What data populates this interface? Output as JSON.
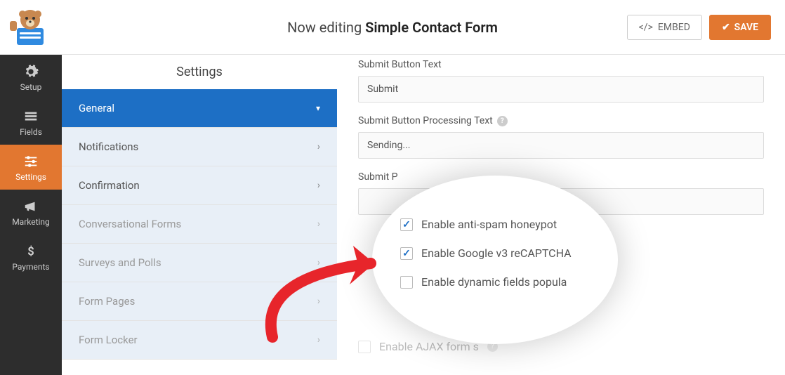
{
  "header": {
    "title_prefix": "Now editing",
    "title_bold": "Simple Contact Form",
    "embed_label": "EMBED",
    "save_label": "SAVE"
  },
  "sidebar": {
    "items": [
      {
        "label": "Setup"
      },
      {
        "label": "Fields"
      },
      {
        "label": "Settings"
      },
      {
        "label": "Marketing"
      },
      {
        "label": "Payments"
      }
    ]
  },
  "subpanel": {
    "title": "Settings",
    "items": [
      {
        "label": "General",
        "active": true
      },
      {
        "label": "Notifications"
      },
      {
        "label": "Confirmation"
      },
      {
        "label": "Conversational Forms",
        "muted": true
      },
      {
        "label": "Surveys and Polls",
        "muted": true
      },
      {
        "label": "Form Pages",
        "muted": true
      },
      {
        "label": "Form Locker",
        "muted": true
      }
    ]
  },
  "form": {
    "submit_text_label": "Submit Button Text",
    "submit_text_value": "Submit",
    "processing_label": "Submit Button Processing Text",
    "processing_value": "Sending...",
    "submit_p_label": "Submit P",
    "checkboxes": [
      {
        "label": "Enable anti-spam honeypot",
        "checked": true
      },
      {
        "label": "Enable Google v3 reCAPTCHA",
        "checked": true
      },
      {
        "label": "Enable dynamic fields popula",
        "checked": false
      },
      {
        "label": "Enable AJAX form s",
        "checked": false
      }
    ]
  }
}
